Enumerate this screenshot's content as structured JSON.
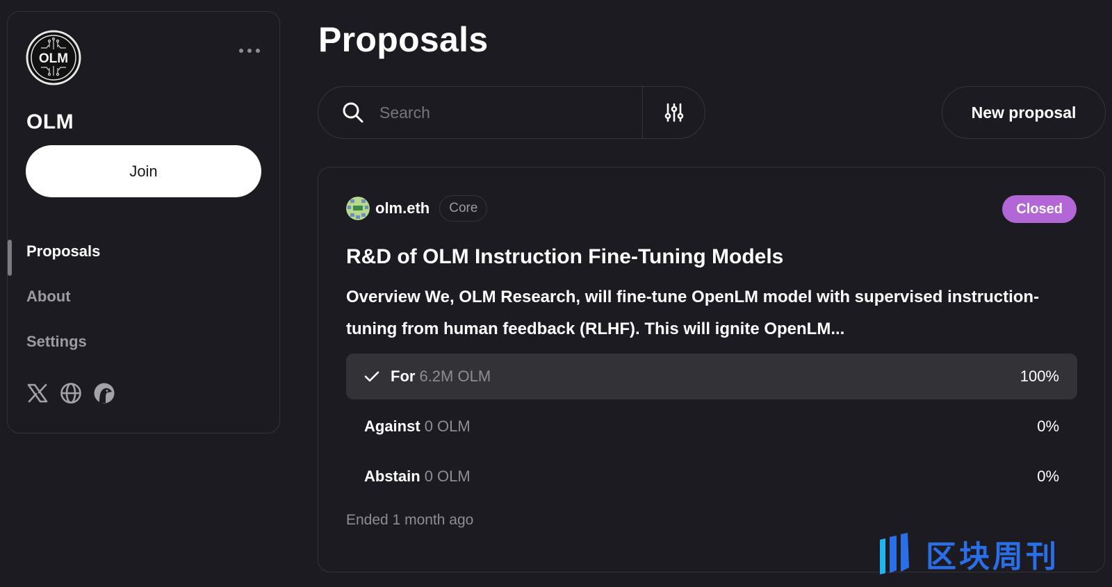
{
  "sidebar": {
    "space_name": "OLM",
    "logo_text": "OLM",
    "join_label": "Join",
    "more_label": "More options",
    "nav": [
      {
        "label": "Proposals",
        "active": true
      },
      {
        "label": "About",
        "active": false
      },
      {
        "label": "Settings",
        "active": false
      }
    ],
    "socials": [
      {
        "icon": "x-twitter-icon"
      },
      {
        "icon": "globe-icon"
      },
      {
        "icon": "github-icon"
      }
    ]
  },
  "main": {
    "title": "Proposals",
    "search": {
      "placeholder": "Search",
      "value": ""
    },
    "filter_icon": "sliders-icon",
    "new_proposal_label": "New proposal"
  },
  "proposal": {
    "author": "olm.eth",
    "author_role": "Core",
    "state": "Closed",
    "state_color": "#b366d6",
    "title": "R&D of OLM Instruction Fine-Tuning Models",
    "body": "Overview We, OLM Research, will fine-tune OpenLM model with supervised instruction-tuning from human feedback (RLHF). This will ignite OpenLM...",
    "results": [
      {
        "choice": "For",
        "score": "6.2M OLM",
        "percent": "100%",
        "fraction": 1.0,
        "voted": true
      },
      {
        "choice": "Against",
        "score": "0 OLM",
        "percent": "0%",
        "fraction": 0.0,
        "voted": false
      },
      {
        "choice": "Abstain",
        "score": "0 OLM",
        "percent": "0%",
        "fraction": 0.0,
        "voted": false
      }
    ],
    "ended": "Ended 1 month ago"
  },
  "watermark": {
    "text": "区块周刊"
  }
}
